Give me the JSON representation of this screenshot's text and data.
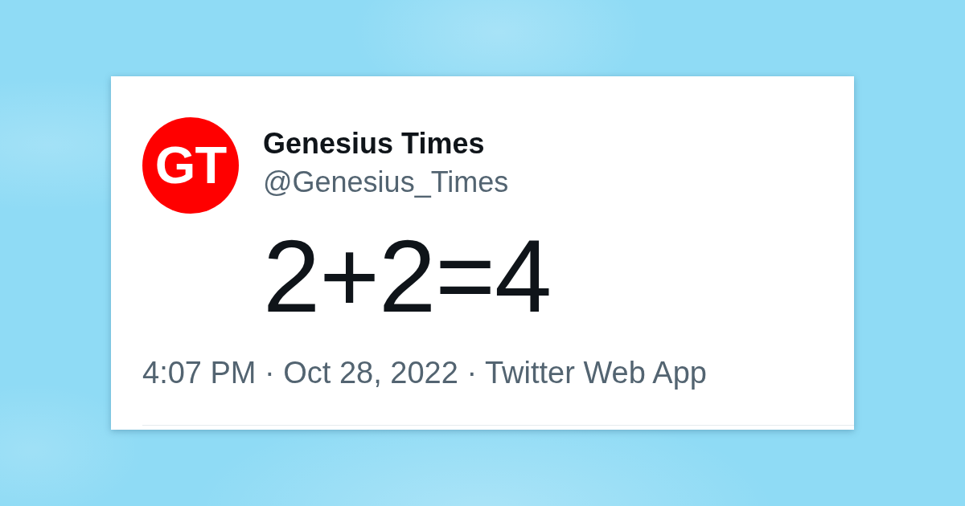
{
  "tweet": {
    "avatar": {
      "initials": "GT"
    },
    "author_name": "Genesius Times",
    "handle": "@Genesius_Times",
    "text": "2+2=4",
    "meta": "4:07 PM · Oct 28, 2022 · Twitter Web App"
  }
}
